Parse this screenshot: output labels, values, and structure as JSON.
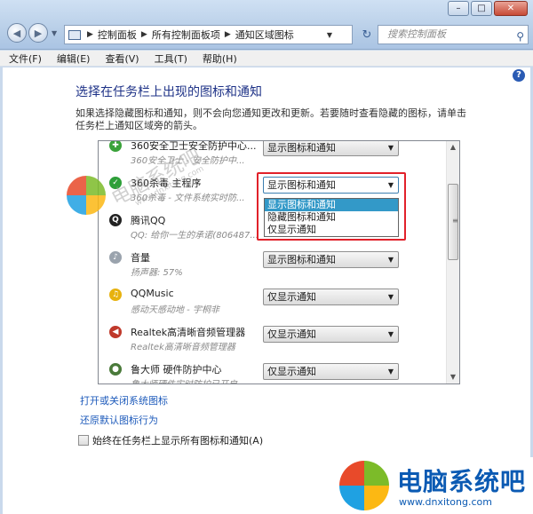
{
  "titlebar": {
    "breadcrumb": [
      "控制面板",
      "所有控制面板项",
      "通知区域图标"
    ],
    "search_placeholder": "搜索控制面板",
    "window_buttons": [
      "–",
      "□",
      "✕"
    ]
  },
  "menu": [
    "文件(F)",
    "编辑(E)",
    "查看(V)",
    "工具(T)",
    "帮助(H)"
  ],
  "content": {
    "heading": "选择在任务栏上出现的图标和通知",
    "description": "如果选择隐藏图标和通知，则不会向您通知更改和更新。若要随时查看隐藏的图标，请单击任务栏上通知区域旁的箭头。",
    "rows": [
      {
        "name": "360安全卫士安全防护中心...",
        "sub": "360安全卫士 - 安全防护中...",
        "value": "显示图标和通知",
        "icon_color": "#3aa23a",
        "icon": "✚"
      },
      {
        "name": "360杀毒 主程序",
        "sub": "360杀毒 - 文件系统实时防...",
        "value": "显示图标和通知",
        "icon_color": "#2e9f39",
        "icon": "✓"
      },
      {
        "name": "腾讯QQ",
        "sub": "QQ: 给你一生的承诺(806487...",
        "value": "",
        "icon_color": "#222222",
        "icon": "Q"
      },
      {
        "name": "音量",
        "sub": "扬声器: 57%",
        "value": "显示图标和通知",
        "icon_color": "#9aa3ad",
        "icon": "♪"
      },
      {
        "name": "QQMusic",
        "sub": "感动天感动地 - 宇桐非",
        "value": "仅显示通知",
        "icon_color": "#e7b20f",
        "icon": "♫"
      },
      {
        "name": "Realtek高清晰音频管理器",
        "sub": "Realtek高清晰音频管理器",
        "value": "仅显示通知",
        "icon_color": "#c0392b",
        "icon": "◀"
      },
      {
        "name": "鲁大师 硬件防护中心",
        "sub": "鲁大师硬件实时防护已开启",
        "value": "仅显示通知",
        "icon_color": "#4a7a3a",
        "icon": "●"
      }
    ],
    "dropdown_options": [
      "显示图标和通知",
      "隐藏图标和通知",
      "仅显示通知"
    ],
    "dropdown_selected": "显示图标和通知",
    "link_system_icons": "打开或关闭系统图标",
    "link_restore": "还原默认图标行为",
    "checkbox_label": "始终在任务栏上显示所有图标和通知(A)"
  },
  "watermark": {
    "text": "电脑系统吧",
    "url": "www.dnxitong.com"
  },
  "colors": {
    "heading": "#1e3287",
    "link": "#1e5bbb",
    "highlight": "#3399c8",
    "callout": "#e1212a"
  }
}
